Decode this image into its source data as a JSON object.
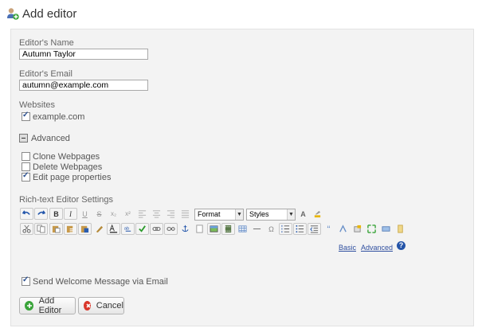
{
  "header": {
    "title": "Add editor",
    "icon": "add-user-icon"
  },
  "name": {
    "label": "Editor's Name",
    "value": "Autumn Taylor"
  },
  "email": {
    "label": "Editor's Email",
    "value": "autumn@example.com"
  },
  "websites": {
    "label": "Websites",
    "items": [
      {
        "label": "example.com",
        "checked": true
      }
    ]
  },
  "advanced": {
    "label": "Advanced",
    "icon": "collapse-icon"
  },
  "permissions": [
    {
      "label": "Clone Webpages",
      "checked": false
    },
    {
      "label": "Delete Webpages",
      "checked": false
    },
    {
      "label": "Edit page properties",
      "checked": true
    }
  ],
  "rte": {
    "label": "Rich-text Editor Settings",
    "row1": [
      "undo-icon",
      "redo-icon",
      "bold-icon",
      "italic-icon",
      "underline-icon",
      "strikethrough-icon",
      "subscript-icon",
      "superscript-icon",
      "align-left-icon",
      "align-center-icon",
      "align-right-icon",
      "align-justify-icon"
    ],
    "format_label": "Format",
    "styles_label": "Styles",
    "row1_end": [
      "text-color-icon",
      "background-color-icon"
    ],
    "row2": [
      "cut-icon",
      "copy-icon",
      "paste-icon",
      "paste-text-icon",
      "paste-word-icon",
      "clean-icon",
      "spellcheck-icon",
      "replace-icon",
      "check-icon",
      "link-icon",
      "unlink-icon",
      "anchor-icon",
      "image-icon",
      "page-icon",
      "flash-icon",
      "media-icon",
      "table-icon",
      "horizontal-rule-icon",
      "special-char-icon",
      "numbered-list-icon",
      "bulleted-list-icon",
      "outdent-icon",
      "indent-icon",
      "blockquote-icon",
      "style-icon",
      "template-icon",
      "maximize-icon",
      "show-blocks-icon",
      "source-icon"
    ],
    "basic_link": "Basic",
    "advanced_link": "Advanced",
    "help_icon": "help-icon"
  },
  "welcome": {
    "label": "Send Welcome Message via Email",
    "checked": true
  },
  "buttons": {
    "add": "Add Editor",
    "cancel": "Cancel"
  },
  "colors": {
    "add_green": "#3aa43a",
    "cancel_red": "#d9372b",
    "link_blue": "#2f4f9f",
    "panel_bg": "#f3f3f3"
  }
}
